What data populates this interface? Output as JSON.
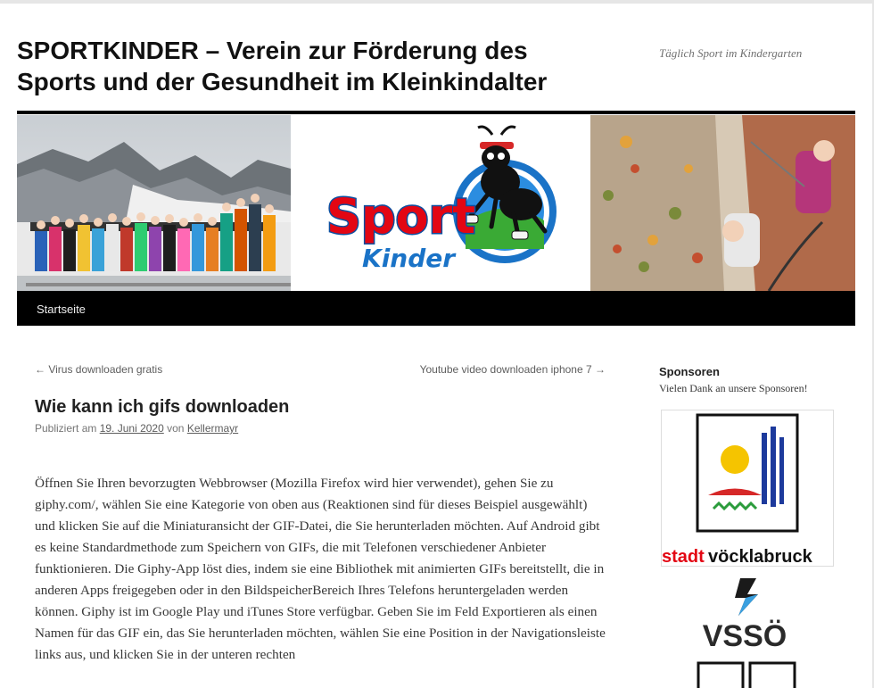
{
  "site": {
    "title": "SPORTKINDER – Verein zur Förderung des Sports und der Gesundheit im Kleinkindalter",
    "description": "Täglich Sport im Kindergarten"
  },
  "banner": {
    "logo_word": "Sport",
    "logo_sub": "Kinder"
  },
  "nav": {
    "home_label": "Startseite"
  },
  "post_nav": {
    "prev": "← Virus downloaden gratis",
    "next": "Youtube video downloaden iphone 7 →"
  },
  "post": {
    "title": "Wie kann ich gifs downloaden",
    "meta_prefix": "Publiziert am",
    "date": "19. Juni 2020",
    "meta_by": "von",
    "author": "Kellermayr",
    "body": "Öffnen Sie Ihren bevorzugten Webbrowser (Mozilla Firefox wird hier verwendet), gehen Sie zu giphy.com/, wählen Sie eine Kategorie von oben aus (Reaktionen sind für dieses Beispiel ausgewählt) und klicken Sie auf die Miniaturansicht der GIF-Datei, die Sie herunterladen möchten. Auf Android gibt es keine Standardmethode zum Speichern von GIFs, die mit Telefonen verschiedener Anbieter funktionieren. Die Giphy-App löst dies, indem sie eine Bibliothek mit animierten GIFs bereitstellt, die in anderen Apps freigegeben oder in den BildspeicherBereich Ihres Telefons heruntergeladen werden können. Giphy ist im Google Play und iTunes Store verfügbar. Geben Sie im Feld Exportieren als einen Namen für das GIF ein, das Sie herunterladen möchten, wählen Sie eine Position in der Navigationsleiste links aus, und klicken Sie in der unteren rechten"
  },
  "sidebar": {
    "title": "Sponsoren",
    "text": "Vielen Dank an unsere Sponsoren!",
    "sponsors": [
      {
        "name_part1": "stadt",
        "name_part2": "vöcklabruck"
      },
      {
        "name": "VSSÖ"
      }
    ]
  },
  "colors": {
    "accent_red": "#e30613",
    "nav_bg": "#000000",
    "link": "#5e5e5e"
  }
}
